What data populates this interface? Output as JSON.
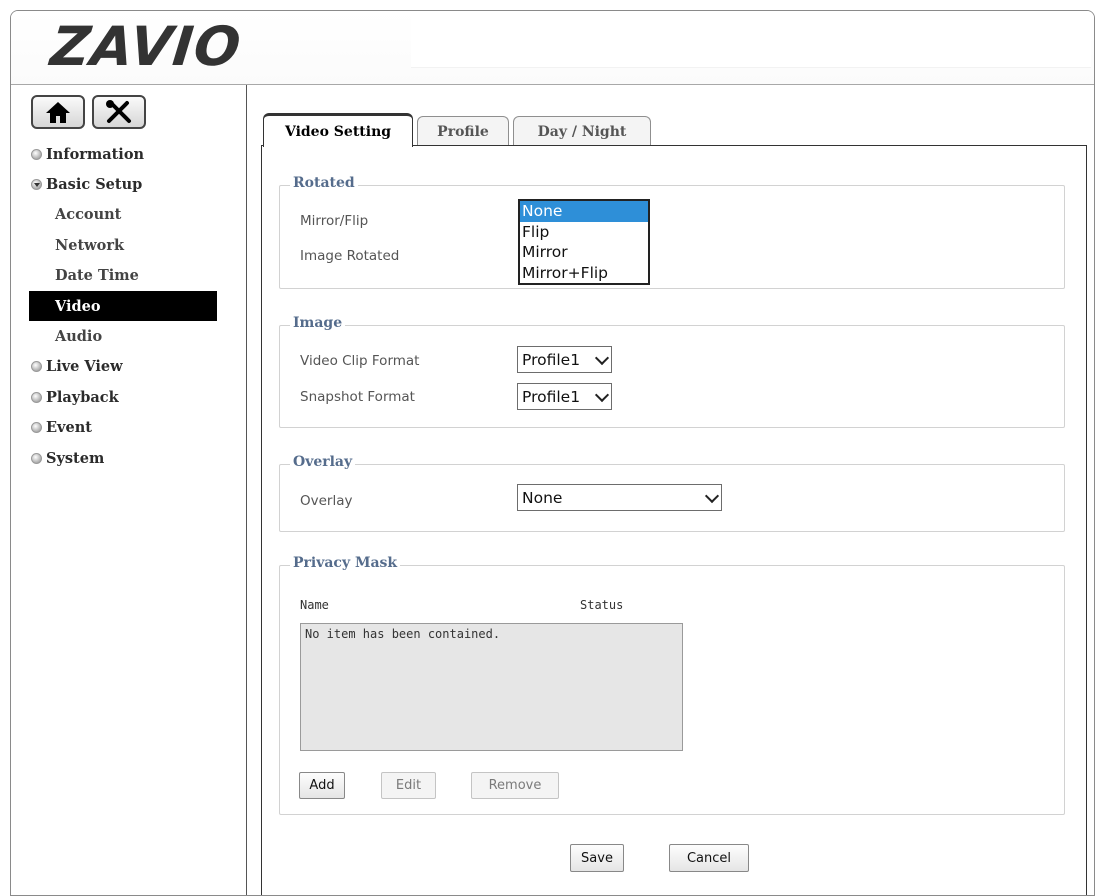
{
  "brand": {
    "logo_text": "ZAVIO"
  },
  "toolbar": {
    "home_icon": "home-icon",
    "settings_icon": "tools-icon"
  },
  "sidebar": {
    "items": [
      {
        "label": "Information"
      },
      {
        "label": "Basic Setup",
        "expanded": true,
        "children": [
          {
            "label": "Account"
          },
          {
            "label": "Network"
          },
          {
            "label": "Date Time"
          },
          {
            "label": "Video",
            "active": true
          },
          {
            "label": "Audio"
          }
        ]
      },
      {
        "label": "Live View"
      },
      {
        "label": "Playback"
      },
      {
        "label": "Event"
      },
      {
        "label": "System"
      }
    ]
  },
  "tabs": [
    {
      "label": "Video Setting",
      "active": true
    },
    {
      "label": "Profile"
    },
    {
      "label": "Day / Night"
    }
  ],
  "rotated": {
    "legend": "Rotated",
    "mirror_flip_label": "Mirror/Flip",
    "image_rotated_label": "Image Rotated",
    "dropdown_options": [
      "None",
      "Flip",
      "Mirror",
      "Mirror+Flip"
    ],
    "selected": "None"
  },
  "image": {
    "legend": "Image",
    "video_clip_label": "Video Clip Format",
    "video_clip_value": "Profile1",
    "snapshot_label": "Snapshot Format",
    "snapshot_value": "Profile1"
  },
  "overlay": {
    "legend": "Overlay",
    "label": "Overlay",
    "value": "None"
  },
  "privacy": {
    "legend": "Privacy Mask",
    "col_name": "Name",
    "col_status": "Status",
    "empty_text": "No item has been contained.",
    "add_label": "Add",
    "edit_label": "Edit",
    "remove_label": "Remove"
  },
  "actions": {
    "save_label": "Save",
    "cancel_label": "Cancel"
  },
  "colors": {
    "legend": "#556c8c",
    "selected_option": "#2e8fd8",
    "active_nav_bg": "#000000"
  }
}
